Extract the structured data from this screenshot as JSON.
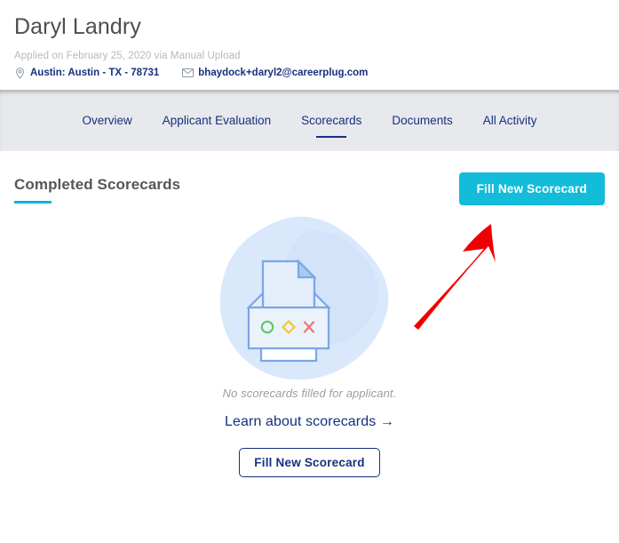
{
  "applicant": {
    "name": "Daryl Landry",
    "applied_line": "Applied on February 25, 2020 via Manual Upload",
    "location": "Austin: Austin - TX - 78731",
    "email": "bhaydock+daryl2@careerplug.com",
    "location_icon": "map-pin-icon",
    "email_icon": "envelope-icon"
  },
  "tabs": [
    {
      "label": "Overview",
      "active": false
    },
    {
      "label": "Applicant Evaluation",
      "active": false
    },
    {
      "label": "Scorecards",
      "active": true
    },
    {
      "label": "Documents",
      "active": false
    },
    {
      "label": "All Activity",
      "active": false
    }
  ],
  "section": {
    "title": "Completed Scorecards",
    "primary_button": "Fill New Scorecard"
  },
  "empty_state": {
    "illustration": "scorecard-document-illustration",
    "message": "No scorecards filled for applicant.",
    "learn_link": "Learn about scorecards →",
    "secondary_button": "Fill New Scorecard",
    "symbols": [
      "green-circle-icon",
      "yellow-diamond-icon",
      "red-x-icon"
    ]
  },
  "annotation": {
    "type": "red-arrow",
    "points_to": "Fill New Scorecard"
  },
  "colors": {
    "accent_cyan": "#13bcd9",
    "navy": "#16307d",
    "tabbar_bg": "#e7e9ed",
    "title_gray": "#53575b",
    "muted_gray": "#9a9ea2",
    "illustration_blue": "#7aa7e3",
    "blob_blue": "#d6e6fa",
    "annotation_red": "#ef0000",
    "symbol_green": "#5ecb5e",
    "symbol_yellow": "#fcc52b",
    "symbol_red": "#f4736f"
  }
}
